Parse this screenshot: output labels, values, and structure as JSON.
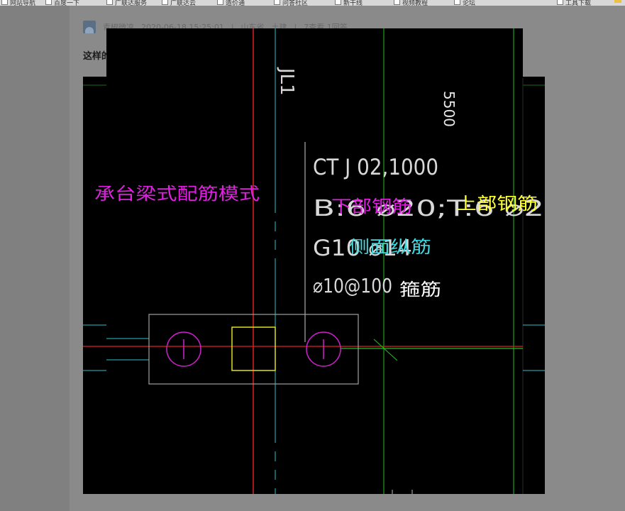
{
  "bookmarks": [
    {
      "label": "网站导航"
    },
    {
      "label": "百度一下"
    },
    {
      "label": "广联达服务"
    },
    {
      "label": "广联达云"
    },
    {
      "label": "造价通"
    },
    {
      "label": "问答社区"
    },
    {
      "label": "新干线"
    },
    {
      "label": "视频教程"
    },
    {
      "label": "论坛"
    },
    {
      "label": "工具下载"
    }
  ],
  "post": {
    "author": "青椒微凉",
    "datetime": "2020-06-18 15:25:01",
    "region": "山东省",
    "category": "土建",
    "stats": "7查看 1回答",
    "title": "这样的"
  },
  "cad": {
    "beam_name": "JL1",
    "dimension": "5500",
    "spec_line1": "CT J 02,1000",
    "spec_line2": "B:6 ⌀20;T:6 ⌀2",
    "spec_line3": "G10 ⌀14",
    "spec_line4": "⌀10@100",
    "annotation_mode": "承台梁式配筋模式",
    "annotation_bottom": "下部钢筋",
    "annotation_top": "上部钢筋",
    "annotation_side": "侧面纵筋",
    "annotation_stirrup": "箍筋",
    "colors": {
      "magenta": "#e020e0",
      "yellow": "#ffff30",
      "cyan": "#40d8e0",
      "white": "#ffffff",
      "red": "#e02020",
      "green": "#20c020",
      "gray": "#d0d0d0"
    }
  }
}
